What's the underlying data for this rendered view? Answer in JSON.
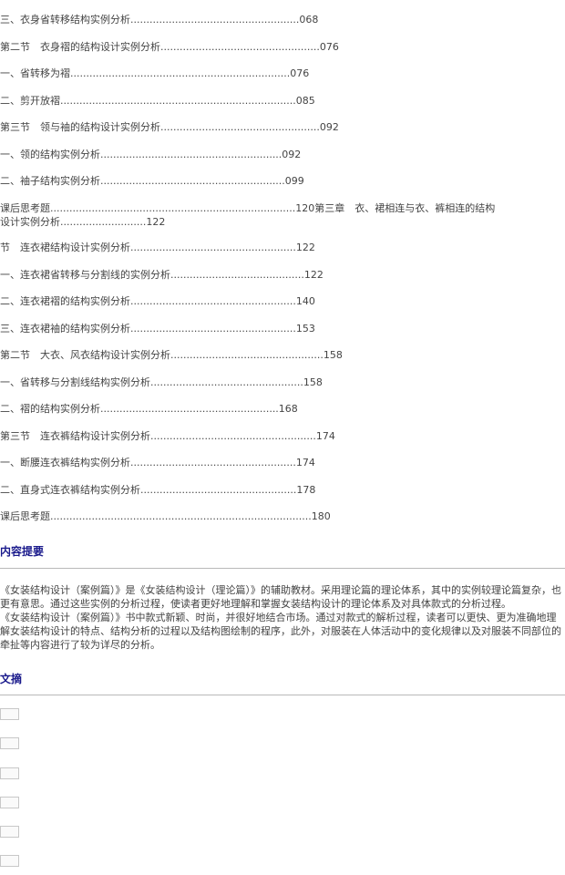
{
  "toc": [
    "三、衣身省转移结构实例分析.....................................................068",
    "第二节　衣身褶的结构设计实例分析..................................................076",
    "一、省转移为褶.....................................................................076",
    "二、剪开放褶..........................................................................085",
    "第三节　领与袖的结构设计实例分析..................................................092",
    "一、领的结构实例分析.........................................................092",
    "二、袖子结构实例分析..........................................................099",
    "课后思考题.............................................................................120第三章　衣、裙相连与衣、裤相连的结构设计实例分析...........................122",
    "节　连衣裙结构设计实例分析....................................................122",
    "一、连衣裙省转移与分割线的实例分析..........................................122",
    "二、连衣裙褶的结构实例分析....................................................140",
    "三、连衣裙袖的结构实例分析....................................................153",
    "第二节　大衣、风衣结构设计实例分析................................................158",
    "一、省转移与分割线结构实例分析................................................158",
    "二、褶的结构实例分析........................................................168",
    "第三节　连衣裤结构设计实例分析....................................................174",
    "一、断腰连衣裤结构实例分析....................................................174",
    "二、直身式连衣裤结构实例分析.................................................178",
    "课后思考题..................................................................................180"
  ],
  "summary_heading": "内容提要",
  "summary_paragraphs": [
    "《女装结构设计（案例篇）》是《女装结构设计（理论篇）》的辅助教材。采用理论篇的理论体系，其中的实例较理论篇复杂，也更有意思。通过这些实例的分析过程，使读者更好地理解和掌握女装结构设计的理论体系及对具体款式的分析过程。",
    "《女装结构设计（案例篇）》书中款式新颖、时尚，并很好地结合市场。通过对款式的解析过程，读者可以更快、更为准确地理解女装结构设计的特点、结构分析的过程以及结构图绘制的程序，此外，对服装在人体活动中的变化规律以及对服装不同部位的牵扯等内容进行了较为详尽的分析。"
  ],
  "excerpt_heading": "文摘",
  "colors": {
    "heading": "#1a1a8c",
    "text": "#444444",
    "rule": "#b9b9b9"
  }
}
